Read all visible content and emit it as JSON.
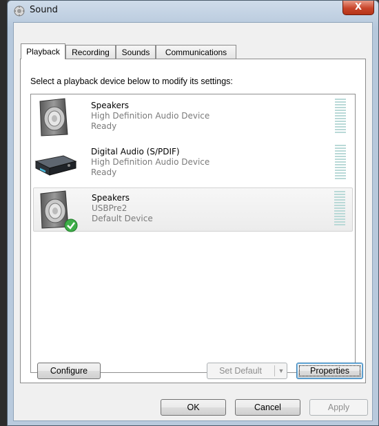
{
  "window": {
    "title": "Sound",
    "close_label": "X"
  },
  "tabs": [
    {
      "label": "Playback",
      "active": true
    },
    {
      "label": "Recording",
      "active": false
    },
    {
      "label": "Sounds",
      "active": false
    },
    {
      "label": "Communications",
      "active": false
    }
  ],
  "playback": {
    "instruction": "Select a playback device below to modify its settings:",
    "devices": [
      {
        "name": "Speakers",
        "line2": "High Definition Audio Device",
        "line3": "Ready",
        "icon": "speaker-icon",
        "default": false,
        "selected": false
      },
      {
        "name": "Digital Audio (S/PDIF)",
        "line2": "High Definition Audio Device",
        "line3": "Ready",
        "icon": "digital-receiver-icon",
        "default": false,
        "selected": false
      },
      {
        "name": "Speakers",
        "line2": "USBPre2",
        "line3": "Default Device",
        "icon": "speaker-icon",
        "default": true,
        "selected": true
      }
    ],
    "buttons": {
      "configure": "Configure",
      "set_default": "Set Default",
      "properties": "Properties"
    }
  },
  "footer": {
    "ok": "OK",
    "cancel": "Cancel",
    "apply": "Apply"
  },
  "colors": {
    "meter": "#b9d9d7",
    "default_check": "#3fae49",
    "close": "#c7442a"
  }
}
